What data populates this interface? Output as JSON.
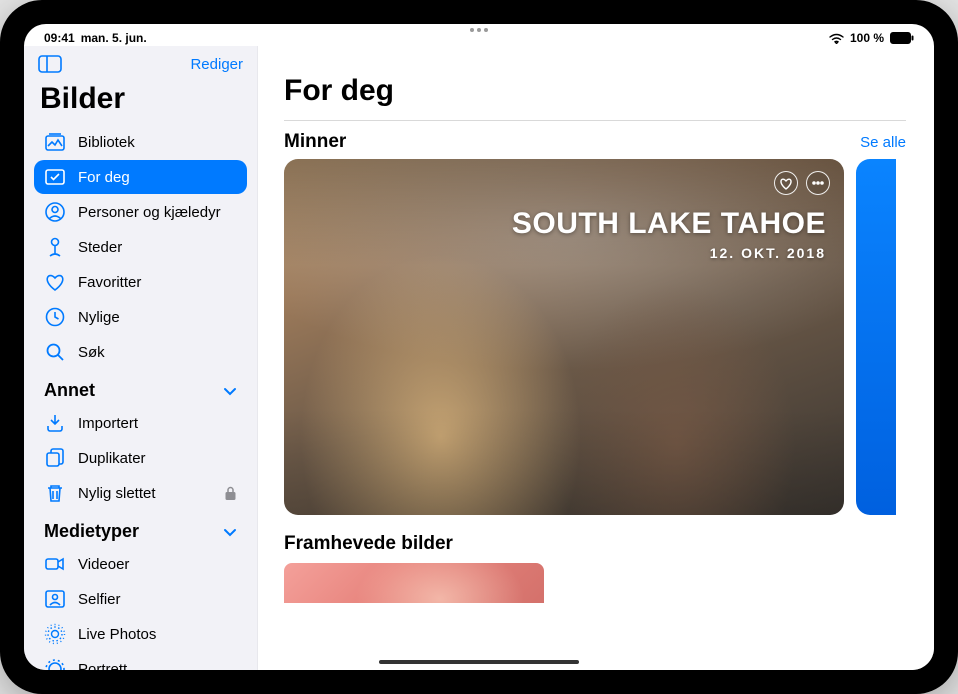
{
  "status": {
    "time": "09:41",
    "date": "man. 5. jun.",
    "battery": "100 %"
  },
  "sidebar": {
    "editLabel": "Rediger",
    "title": "Bilder",
    "items": [
      {
        "id": "library",
        "label": "Bibliotek"
      },
      {
        "id": "for-you",
        "label": "For deg"
      },
      {
        "id": "people-pets",
        "label": "Personer og kjæledyr"
      },
      {
        "id": "places",
        "label": "Steder"
      },
      {
        "id": "favorites",
        "label": "Favoritter"
      },
      {
        "id": "recent",
        "label": "Nylige"
      },
      {
        "id": "search",
        "label": "Søk"
      }
    ],
    "sectionOther": "Annet",
    "otherItems": [
      {
        "id": "imported",
        "label": "Importert"
      },
      {
        "id": "duplicates",
        "label": "Duplikater"
      },
      {
        "id": "recently-deleted",
        "label": "Nylig slettet",
        "locked": true
      }
    ],
    "sectionMedia": "Medietyper",
    "mediaItems": [
      {
        "id": "videos",
        "label": "Videoer"
      },
      {
        "id": "selfies",
        "label": "Selfier"
      },
      {
        "id": "live-photos",
        "label": "Live Photos"
      },
      {
        "id": "portrait",
        "label": "Portrett"
      }
    ]
  },
  "content": {
    "pageTitle": "For deg",
    "memoriesHeading": "Minner",
    "seeAll": "Se alle",
    "memory": {
      "title": "SOUTH LAKE TAHOE",
      "date": "12. OKT. 2018"
    },
    "featuredHeading": "Framhevede bilder"
  }
}
